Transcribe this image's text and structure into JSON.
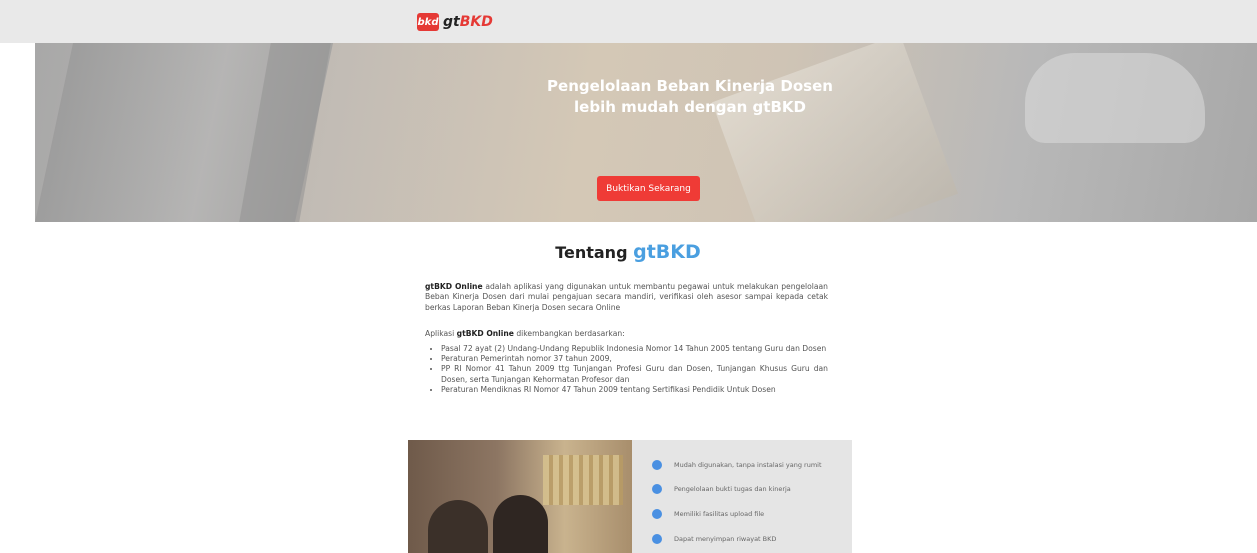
{
  "logo": {
    "badge": "bkd",
    "prefix": "gt",
    "suffix": "BKD"
  },
  "hero": {
    "title_line1": "Pengelolaan Beban Kinerja Dosen",
    "title_line2": "lebih mudah dengan gtBKD",
    "button_label": "Buktikan Sekarang"
  },
  "about": {
    "heading": "Tentang",
    "heading_brand": "gtBKD",
    "intro_bold": "gtBKD Online",
    "intro_text": " adalah aplikasi yang digunakan untuk membantu pegawai untuk melakukan pengelolaan Beban Kinerja Dosen dari mulai pengajuan secara mandiri, verifikasi oleh asesor sampai kepada cetak berkas Laporan Beban Kinerja Dosen secara Online",
    "basis_prefix": "Aplikasi ",
    "basis_bold": "gtBKD Online",
    "basis_suffix": " dikembangkan berdasarkan:",
    "basis_items": [
      "Pasal 72 ayat (2) Undang-Undang Republik Indonesia Nomor 14 Tahun 2005 tentang Guru dan Dosen",
      "Peraturan Pemerintah nomor 37 tahun 2009,",
      "PP RI Nomor 41 Tahun 2009 ttg Tunjangan Profesi Guru dan Dosen, Tunjangan Khusus Guru dan Dosen, serta Tunjangan Kehormatan Profesor dan",
      "Peraturan Mendiknas RI Nomor 47 Tahun 2009 tentang Sertifikasi Pendidik Untuk Dosen"
    ]
  },
  "features": [
    "Mudah digunakan, tanpa instalasi yang rumit",
    "Pengelolaan bukti tugas dan kinerja",
    "Memiliki fasilitas upload file",
    "Dapat menyimpan riwayat BKD"
  ],
  "colors": {
    "accent_red": "#ef3b36",
    "brand_blue": "#4a9fe0",
    "dot_blue": "#4a90e2"
  }
}
